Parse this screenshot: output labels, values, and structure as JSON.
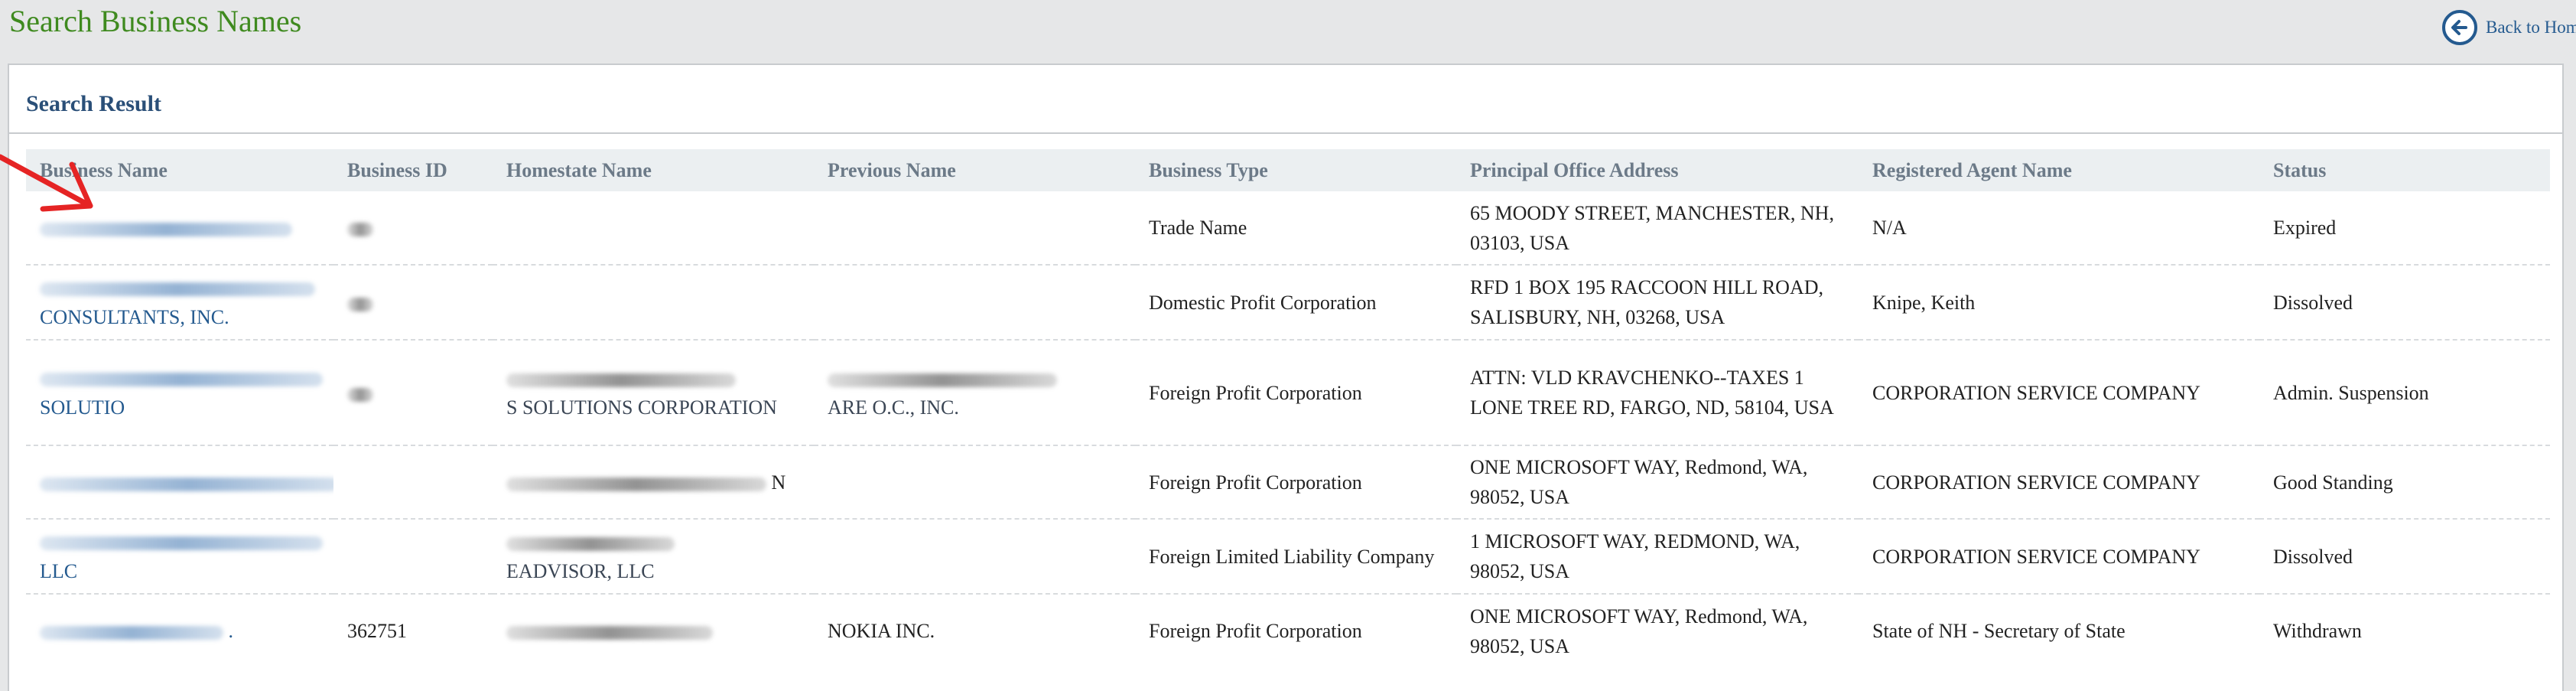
{
  "page": {
    "title": "Search Business Names",
    "back_label": "Back to Home"
  },
  "panel": {
    "heading": "Search Result"
  },
  "table": {
    "headers": [
      "Business Name",
      "Business ID",
      "Homestate Name",
      "Previous Name",
      "Business Type",
      "Principal Office Address",
      "Registered Agent Name",
      "Status"
    ],
    "rows": [
      {
        "business_name_suffix": "",
        "business_id": "",
        "homestate_name_suffix": "",
        "previous_name_suffix": "",
        "business_type": "Trade Name",
        "address": "65 MOODY STREET, MANCHESTER, NH, 03103, USA",
        "agent": "N/A",
        "status": "Expired"
      },
      {
        "business_name_suffix": "CONSULTANTS, INC.",
        "business_id": "",
        "homestate_name_suffix": "",
        "previous_name_suffix": "",
        "business_type": "Domestic Profit Corporation",
        "address": "RFD 1 BOX 195 RACCOON HILL ROAD, SALISBURY, NH, 03268, USA",
        "agent": "Knipe, Keith",
        "status": "Dissolved"
      },
      {
        "business_name_suffix": "SOLUTIO",
        "business_id": "",
        "homestate_name_suffix": "S SOLUTIONS CORPORATION",
        "previous_name_suffix": "ARE O.C., INC.",
        "business_type": "Foreign Profit Corporation",
        "address": "ATTN: VLD KRAVCHENKO--TAXES 1 LONE TREE RD, FARGO, ND, 58104, USA",
        "agent": "CORPORATION SERVICE COMPANY",
        "status": "Admin. Suspension"
      },
      {
        "business_name_suffix": "",
        "business_id": "",
        "homestate_name_suffix": "N",
        "previous_name_suffix": "",
        "business_type": "Foreign Profit Corporation",
        "address": "ONE MICROSOFT WAY, Redmond, WA, 98052, USA",
        "agent": "CORPORATION SERVICE COMPANY",
        "status": "Good Standing"
      },
      {
        "business_name_suffix": "LLC",
        "business_id": "",
        "homestate_name_suffix": "EADVISOR, LLC",
        "previous_name_suffix": "",
        "business_type": "Foreign Limited Liability Company",
        "address": "1 MICROSOFT WAY, REDMOND, WA, 98052, USA",
        "agent": "CORPORATION SERVICE COMPANY",
        "status": "Dissolved"
      },
      {
        "business_name_suffix": ".",
        "business_id": "362751",
        "homestate_name_suffix": "",
        "previous_name_suffix": "NOKIA INC.",
        "business_type": "Foreign Profit Corporation",
        "address": "ONE MICROSOFT WAY, Redmond, WA, 98052, USA",
        "agent": "State of NH - Secretary of State",
        "status": "Withdrawn"
      }
    ]
  },
  "colors": {
    "title_green": "#3f8a1f",
    "link_blue": "#245a8f",
    "header_gray": "#6c7a88",
    "annotation_red": "#e52424"
  },
  "icons": {
    "back": "back-arrow-circle-icon",
    "annotation": "red-arrow-icon"
  }
}
